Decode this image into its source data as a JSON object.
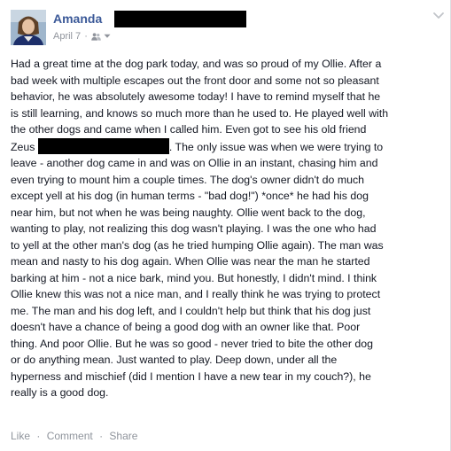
{
  "post": {
    "author": "Amanda",
    "date": "April 7",
    "meta_separator": "·",
    "audience_icon": "friends-icon",
    "body_lines": [
      "Had a great time at the dog park today, and was so proud of my Ollie. After a",
      "bad week with multiple escapes out the front door and some not so pleasant",
      "behavior, he was absolutely awesome today! I have to remind myself that he",
      "is still learning, and knows so much more than he used to. He played well with",
      "the other dogs and came when I called him. Even got to see his old friend"
    ],
    "line6_before": "Zeus",
    "line6_after": ". The only issue was when we were trying to",
    "body_lines_rest": [
      "leave - another dog came in and was on Ollie in an instant, chasing him and",
      "even trying to mount him a couple times. The dog's owner didn't do much",
      "except yell at his dog (in human terms - \"bad dog!\") *once* he had his dog",
      "near him, but not when he was being naughty. Ollie went back to the dog,",
      "wanting to play, not realizing this dog wasn't playing. I was the one who had",
      "to yell at the other man's dog (as he tried humping Ollie again). The man was",
      "mean and nasty to his dog again. When Ollie was near the man he started",
      "barking at him - not a nice bark, mind you. But honestly, I didn't mind. I think",
      "Ollie knew this was not a nice man, and I really think he was trying to protect",
      "me. The man and his dog left, and I couldn't help but think that his dog just",
      "doesn't have a chance of being a good dog with an owner like that. Poor",
      "thing. And poor Ollie. But he was so good - never tried to bite the other dog",
      "or do anything mean. Just wanted to play. Deep down, under all the",
      "hyperness and mischief (did I mention I have a new tear in my couch?), he",
      "really is a good dog."
    ]
  },
  "actions": {
    "like": "Like",
    "comment": "Comment",
    "share": "Share",
    "separator": "·"
  },
  "colors": {
    "author_link": "#3b5998",
    "body_text": "#141823",
    "meta_text": "#90949c",
    "redaction": "#000000"
  }
}
